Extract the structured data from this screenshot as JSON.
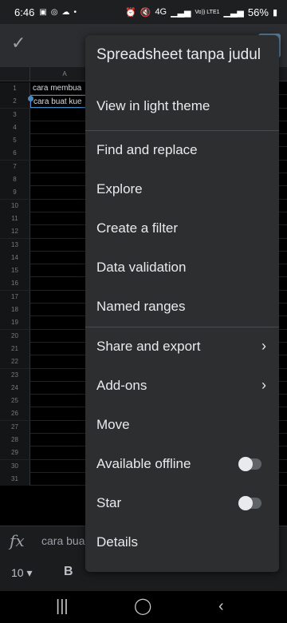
{
  "status": {
    "time": "6:46",
    "battery": "56%",
    "network_labels": [
      "4G",
      "Vo)) LTE1"
    ]
  },
  "sheet": {
    "column_header": "A",
    "row_numbers": [
      "1",
      "2",
      "3",
      "4",
      "5",
      "6",
      "7",
      "8",
      "9",
      "10",
      "11",
      "12",
      "13",
      "14",
      "15",
      "16",
      "17",
      "18",
      "19",
      "20",
      "21",
      "22",
      "23",
      "24",
      "25",
      "26",
      "27",
      "28",
      "29",
      "30",
      "31"
    ],
    "cells": {
      "a1": "cara membua",
      "a2": "cara buat kue"
    }
  },
  "formula_bar": {
    "value": "cara bua"
  },
  "format_bar": {
    "font_size": "10",
    "bold_label": "B"
  },
  "menu": {
    "title": "Spreadsheet tanpa judul",
    "items": [
      {
        "label": "View in light theme"
      },
      {
        "label": "Find and replace"
      },
      {
        "label": "Explore"
      },
      {
        "label": "Create a filter"
      },
      {
        "label": "Data validation"
      },
      {
        "label": "Named ranges"
      },
      {
        "label": "Share and export"
      },
      {
        "label": "Add-ons"
      },
      {
        "label": "Move"
      },
      {
        "label": "Available offline",
        "toggle": false
      },
      {
        "label": "Star",
        "toggle": false
      },
      {
        "label": "Details"
      }
    ]
  },
  "icons": [
    "check-icon",
    "fx-icon",
    "chevron-right-icon",
    "recents-icon",
    "home-icon",
    "back-icon"
  ],
  "colors": {
    "menu_bg": "#2d2e30",
    "selection": "#4b87c2",
    "accent_button": "#5b7f9a"
  }
}
